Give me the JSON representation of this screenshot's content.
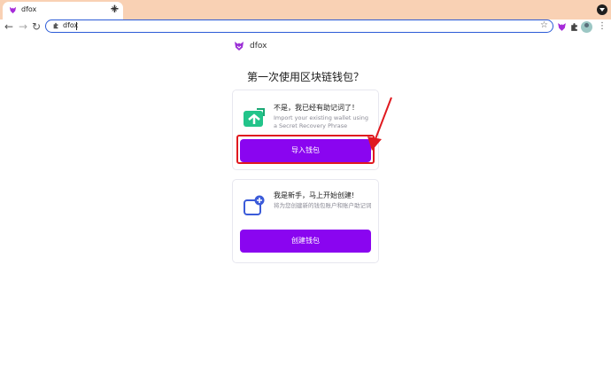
{
  "browser": {
    "tab_title": "dfox",
    "close_glyph": "×",
    "new_tab_glyph": "+",
    "back_glyph": "←",
    "forward_glyph": "→",
    "reload_glyph": "↻",
    "address_text": "dfox",
    "bookmark_glyph": "☆",
    "menu_glyph": "⋮"
  },
  "page": {
    "brand_name": "dfox",
    "heading": "第一次使用区块链钱包？",
    "import_card": {
      "title": "不是，我已经有助记词了！",
      "description": "Import your existing wallet using a Secret Recovery Phrase",
      "button_label": "导入钱包",
      "icon": "import-wallet-icon"
    },
    "create_card": {
      "title": "我是新手，马上开始创建!",
      "description": "将为您创建新的钱包账户和账户助记词",
      "button_label": "创建钱包",
      "icon": "create-wallet-icon"
    }
  },
  "colors": {
    "accent": "#8a05f0",
    "tabstrip": "#f9d1b4",
    "annotation": "#e0191f",
    "import_icon": "#22c48a",
    "create_icon": "#3b5bd9"
  }
}
